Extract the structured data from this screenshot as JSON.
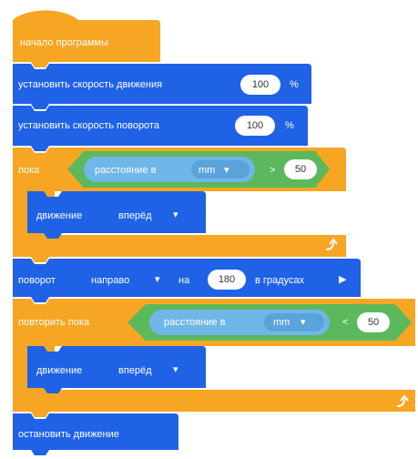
{
  "blocks": {
    "start": "начало программы",
    "set_speed": {
      "label": "установить скорость движения",
      "value": "100",
      "unit": "%"
    },
    "set_turn_speed": {
      "label": "установить скорость поворота",
      "value": "100",
      "unit": "%"
    },
    "while1": {
      "label": "пока",
      "sensor_label": "расстояние в",
      "sensor_unit": "mm",
      "operator": ">",
      "value": "50",
      "body": {
        "label": "движение",
        "direction": "вперёд"
      }
    },
    "turn": {
      "label": "поворот",
      "direction": "направо",
      "on": "на",
      "value": "180",
      "unit": "в градусах"
    },
    "repeat_until": {
      "label": "повторить пока",
      "sensor_label": "расстояние в",
      "sensor_unit": "mm",
      "operator": "<",
      "value": "50",
      "body": {
        "label": "движение",
        "direction": "вперёд"
      }
    },
    "stop": "остановить движение"
  },
  "colors": {
    "control_orange": "#f6a623",
    "motion_blue": "#1f62e6",
    "sensor_green": "#5cb85c",
    "sensor_light": "#6fb7e8",
    "white": "#ffffff"
  }
}
